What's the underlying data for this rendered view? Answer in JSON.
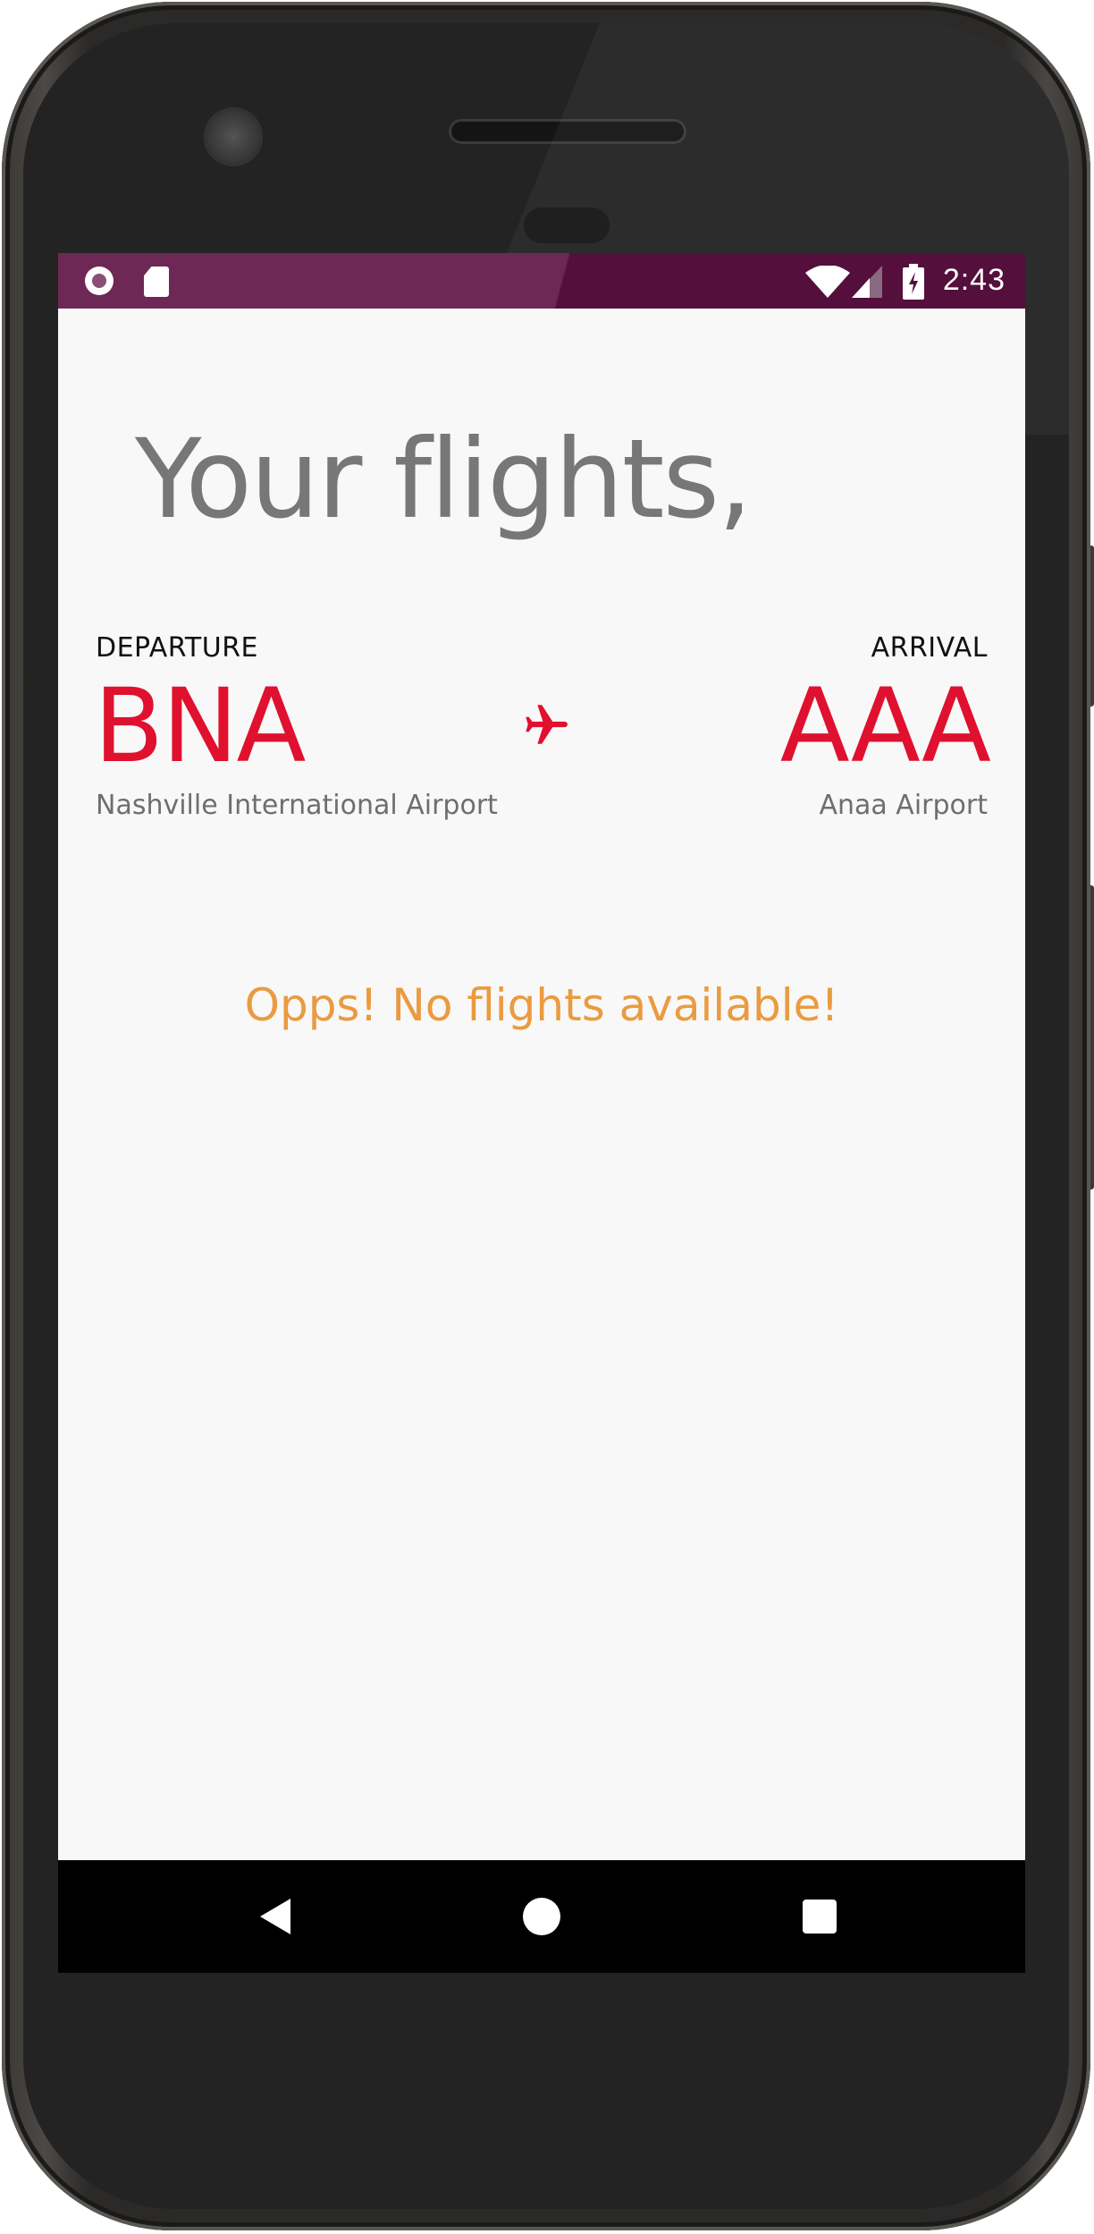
{
  "status_bar": {
    "time": "2:43",
    "left_icons": [
      "record-icon",
      "sd-card-icon"
    ],
    "right_icons": [
      "wifi-icon",
      "cell-signal-icon",
      "battery-charging-icon"
    ]
  },
  "page": {
    "title": "Your flights,"
  },
  "route": {
    "departure": {
      "label": "DEPARTURE",
      "code": "BNA",
      "airport": "Nashville International Airport"
    },
    "arrival": {
      "label": "ARRIVAL",
      "code": "AAA",
      "airport": "Anaa Airport"
    },
    "separator_icon": "airplane-icon"
  },
  "results": {
    "empty_message": "Opps! No flights available!"
  },
  "navigation": {
    "buttons": [
      "back-icon",
      "home-icon",
      "recents-icon"
    ]
  },
  "colors": {
    "status_bar": "#6e2856",
    "accent_red": "#e0102f",
    "message_orange": "#ea9b40",
    "title_gray": "#777777",
    "screen_bg": "#f8f8f8"
  }
}
